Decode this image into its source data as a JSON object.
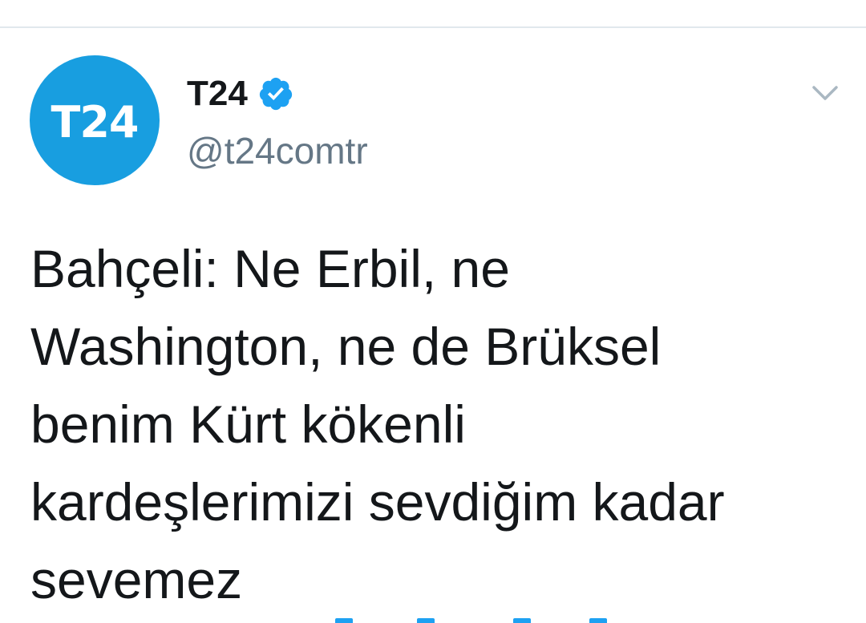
{
  "account": {
    "display_name": "T24",
    "handle": "@t24comtr",
    "avatar_text": "T24",
    "verified": true
  },
  "tweet": {
    "text": "Bahçeli: Ne Erbil, ne\nWashington, ne de Brüksel\nbenim Kürt kökenli\nkardeşlerimizi sevdiğim kadar\nsevemez"
  },
  "icons": {
    "verified": "verified-badge-icon",
    "menu": "chevron-down-icon"
  },
  "colors": {
    "brand_blue": "#189ee0",
    "verified_blue": "#1da1f2",
    "text": "#14171a",
    "secondary_text": "#657786",
    "divider": "#e1e8ed"
  }
}
